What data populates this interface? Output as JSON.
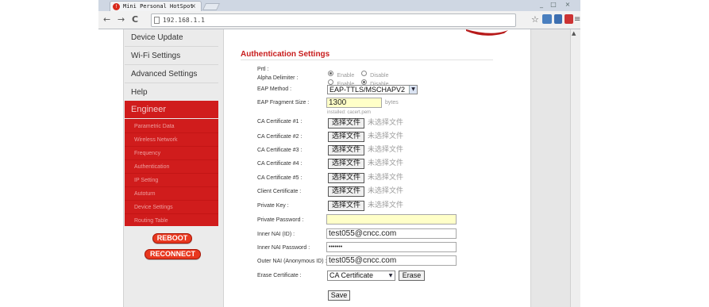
{
  "browser": {
    "tab_title": "Mini Personal HotSpot",
    "tab_close": "×",
    "url": "192.168.1.1",
    "window_controls": [
      "_",
      "□",
      "×"
    ],
    "icons": [
      "back-icon",
      "forward-icon",
      "reload-icon",
      "star-icon",
      "menu-icon"
    ]
  },
  "sidebar": {
    "items": [
      "Device Update",
      "Wi-Fi Settings",
      "Advanced Settings",
      "Help"
    ],
    "engineer_label": "Engineer",
    "subitems": [
      "Parametric Data",
      "Wireless Network",
      "Frequency",
      "Authentication",
      "IP Setting",
      "Autoturn",
      "Device Settings",
      "Routing Table"
    ],
    "reboot_label": "REBOOT",
    "reconnect_label": "RECONNECT"
  },
  "form": {
    "title": "Authentication Settings",
    "prtl_label": "Prtl :",
    "alpha_label": "Alpha Delimiter :",
    "enable_label": "Enable",
    "disable_label": "Disable",
    "prtl_selected": "Enable",
    "alpha_selected": "Disable",
    "eap_method_label": "EAP Method :",
    "eap_method_value": "EAP-TTLS/MSCHAPV2",
    "eap_fragment_label": "EAP Fragment Size :",
    "eap_fragment_value": "1300",
    "eap_fragment_unit": "bytes",
    "installed_hint": "installed: cacert.pem",
    "certificates": [
      {
        "label": "CA Certificate #1 :",
        "button": "选择文件",
        "status": "未选择文件"
      },
      {
        "label": "CA Certificate #2 :",
        "button": "选择文件",
        "status": "未选择文件"
      },
      {
        "label": "CA Certificate #3 :",
        "button": "选择文件",
        "status": "未选择文件"
      },
      {
        "label": "CA Certificate #4 :",
        "button": "选择文件",
        "status": "未选择文件"
      },
      {
        "label": "CA Certificate #5 :",
        "button": "选择文件",
        "status": "未选择文件"
      },
      {
        "label": "Client Certificate :",
        "button": "选择文件",
        "status": "未选择文件"
      },
      {
        "label": "Private Key :",
        "button": "选择文件",
        "status": "未选择文件"
      }
    ],
    "private_password_label": "Private Password :",
    "private_password_value": "",
    "inner_nai_label": "Inner NAI (ID) :",
    "inner_nai_value": "test055@cncc.com",
    "inner_nai_password_label": "Inner NAI Password :",
    "inner_nai_password_value": "•••••••",
    "outer_nai_label": "Outer NAI (Anonymous ID) :",
    "outer_nai_value": "test055@cncc.com",
    "erase_certificate_label": "Erase Certificate :",
    "erase_certificate_value": "CA Certificate",
    "erase_button": "Erase",
    "save_button": "Save"
  }
}
